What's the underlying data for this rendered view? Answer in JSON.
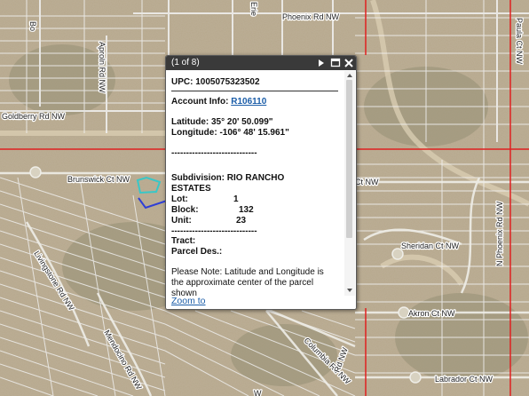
{
  "map": {
    "streets": [
      "Phoenix Rd NW",
      "Goldberry Rd NW",
      "Brunswick Ct NW",
      "Sheridan Ct NW",
      "Akron Ct NW",
      "Labrador Ct NW",
      "Livingstone Rd NW",
      "Columbia Rd NW",
      "Mendocino Rd NW",
      "N Phoenix Rd NW",
      "Paula Ct NW",
      "Aproln Rd NW",
      "Ct NW",
      "Bo",
      "Erie",
      "Rd NW",
      "W"
    ],
    "colors": {
      "boundary_red": "#e02020",
      "selected_parcel": "#2f3fd6",
      "highlight_parcel": "#39c7c7",
      "parcel_lines": "#f2f2f2"
    }
  },
  "popup": {
    "title": "(1 of 8)",
    "next_icon": "triangle-right-icon",
    "maximize_icon": "maximize-icon",
    "close_icon": "close-icon",
    "upc_label": "UPC: ",
    "upc_value": "1005075323502",
    "account_label": "Account Info: ",
    "account_value": "R106110",
    "latitude_label": "Latitude: ",
    "latitude_value": "35° 20' 50.099\"",
    "longitude_label": "Longitude: ",
    "longitude_value": "-106° 48' 15.961\"",
    "divider": "-----------------------------",
    "subdivision_label": "Subdivision: ",
    "subdivision_value_line1": "RIO RANCHO",
    "subdivision_value_line2": "ESTATES",
    "lot_label": "Lot:",
    "lot_value": "1",
    "block_label": "Block:",
    "block_value": "132",
    "unit_label": "Unit:",
    "unit_value": "23",
    "tract_label": "Tract:",
    "parcel_des_label": "Parcel Des.:",
    "note_line1": "Please Note: Latitude and Longitude is",
    "note_line2": "the approximate center of the parcel",
    "note_line3": "shown",
    "zoom_label": "Zoom to"
  }
}
